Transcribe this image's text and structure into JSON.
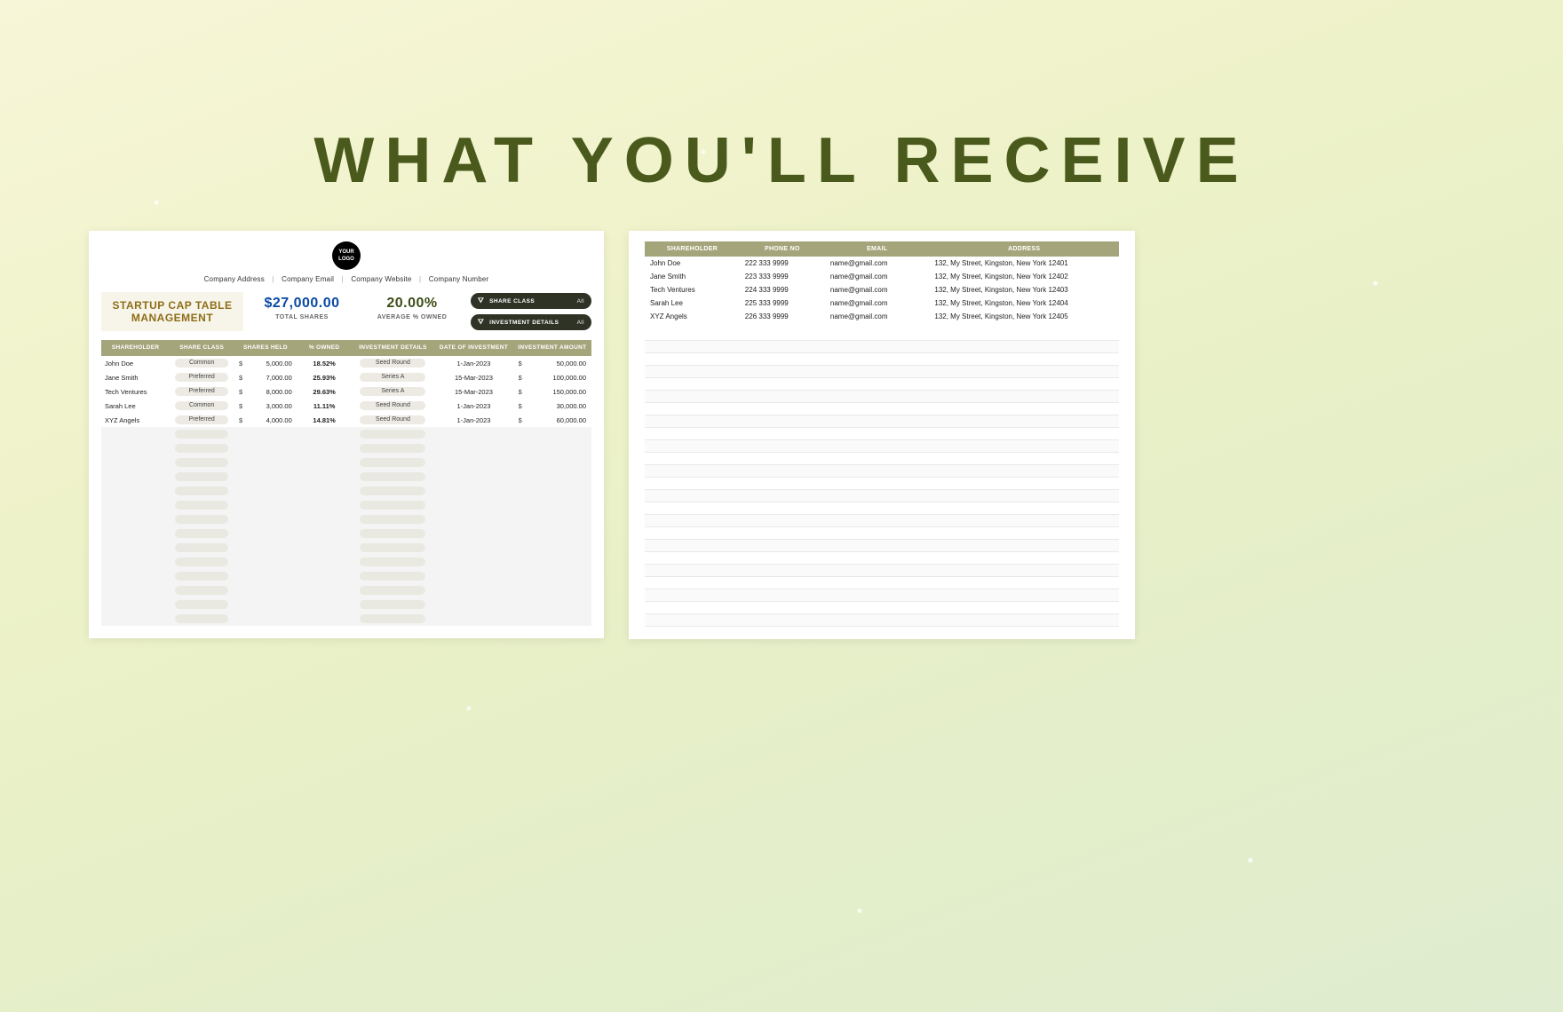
{
  "heading": "WHAT YOU'LL RECEIVE",
  "left": {
    "logo": {
      "line1": "YOUR",
      "line2": "LOGO"
    },
    "company_info": [
      "Company Address",
      "Company Email",
      "Company Website",
      "Company Number"
    ],
    "title": "STARTUP CAP TABLE MANAGEMENT",
    "metrics": {
      "total_shares": {
        "value": "$27,000.00",
        "label": "TOTAL SHARES"
      },
      "avg_owned": {
        "value": "20.00%",
        "label": "AVERAGE % OWNED"
      }
    },
    "filters": {
      "share_class": {
        "label": "SHARE CLASS",
        "value": "All"
      },
      "investment": {
        "label": "INVESTMENT DETAILS",
        "value": "All"
      }
    },
    "columns": [
      "SHAREHOLDER",
      "SHARE CLASS",
      "SHARES HELD",
      "% OWNED",
      "INVESTMENT DETAILS",
      "DATE OF INVESTMENT",
      "INVESTMENT AMOUNT"
    ],
    "rows": [
      {
        "shareholder": "John Doe",
        "share_class": "Common",
        "shares_held": "5,000.00",
        "pct_owned": "18.52%",
        "investment_details": "Seed Round",
        "date": "1-Jan-2023",
        "amount": "50,000.00"
      },
      {
        "shareholder": "Jane Smith",
        "share_class": "Preferred",
        "shares_held": "7,000.00",
        "pct_owned": "25.93%",
        "investment_details": "Series A",
        "date": "15-Mar-2023",
        "amount": "100,000.00"
      },
      {
        "shareholder": "Tech Ventures",
        "share_class": "Preferred",
        "shares_held": "8,000.00",
        "pct_owned": "29.63%",
        "investment_details": "Series A",
        "date": "15-Mar-2023",
        "amount": "150,000.00"
      },
      {
        "shareholder": "Sarah Lee",
        "share_class": "Common",
        "shares_held": "3,000.00",
        "pct_owned": "11.11%",
        "investment_details": "Seed Round",
        "date": "1-Jan-2023",
        "amount": "30,000.00"
      },
      {
        "shareholder": "XYZ Angels",
        "share_class": "Preferred",
        "shares_held": "4,000.00",
        "pct_owned": "14.81%",
        "investment_details": "Seed Round",
        "date": "1-Jan-2023",
        "amount": "60,000.00"
      }
    ],
    "empty_rows": 14
  },
  "right": {
    "columns": [
      "SHAREHOLDER",
      "PHONE NO",
      "EMAIL",
      "ADDRESS"
    ],
    "rows": [
      {
        "shareholder": "John Doe",
        "phone": "222 333 9999",
        "email": "name@gmail.com",
        "address": "132, My Street, Kingston, New York 12401"
      },
      {
        "shareholder": "Jane Smith",
        "phone": "223 333 9999",
        "email": "name@gmail.com",
        "address": "132, My Street, Kingston, New York 12402"
      },
      {
        "shareholder": "Tech Ventures",
        "phone": "224 333 9999",
        "email": "name@gmail.com",
        "address": "132, My Street, Kingston, New York 12403"
      },
      {
        "shareholder": "Sarah Lee",
        "phone": "225 333 9999",
        "email": "name@gmail.com",
        "address": "132, My Street, Kingston, New York 12404"
      },
      {
        "shareholder": "XYZ Angels",
        "phone": "226 333 9999",
        "email": "name@gmail.com",
        "address": "132, My Street, Kingston, New York 12405"
      }
    ],
    "empty_lines": 24
  }
}
